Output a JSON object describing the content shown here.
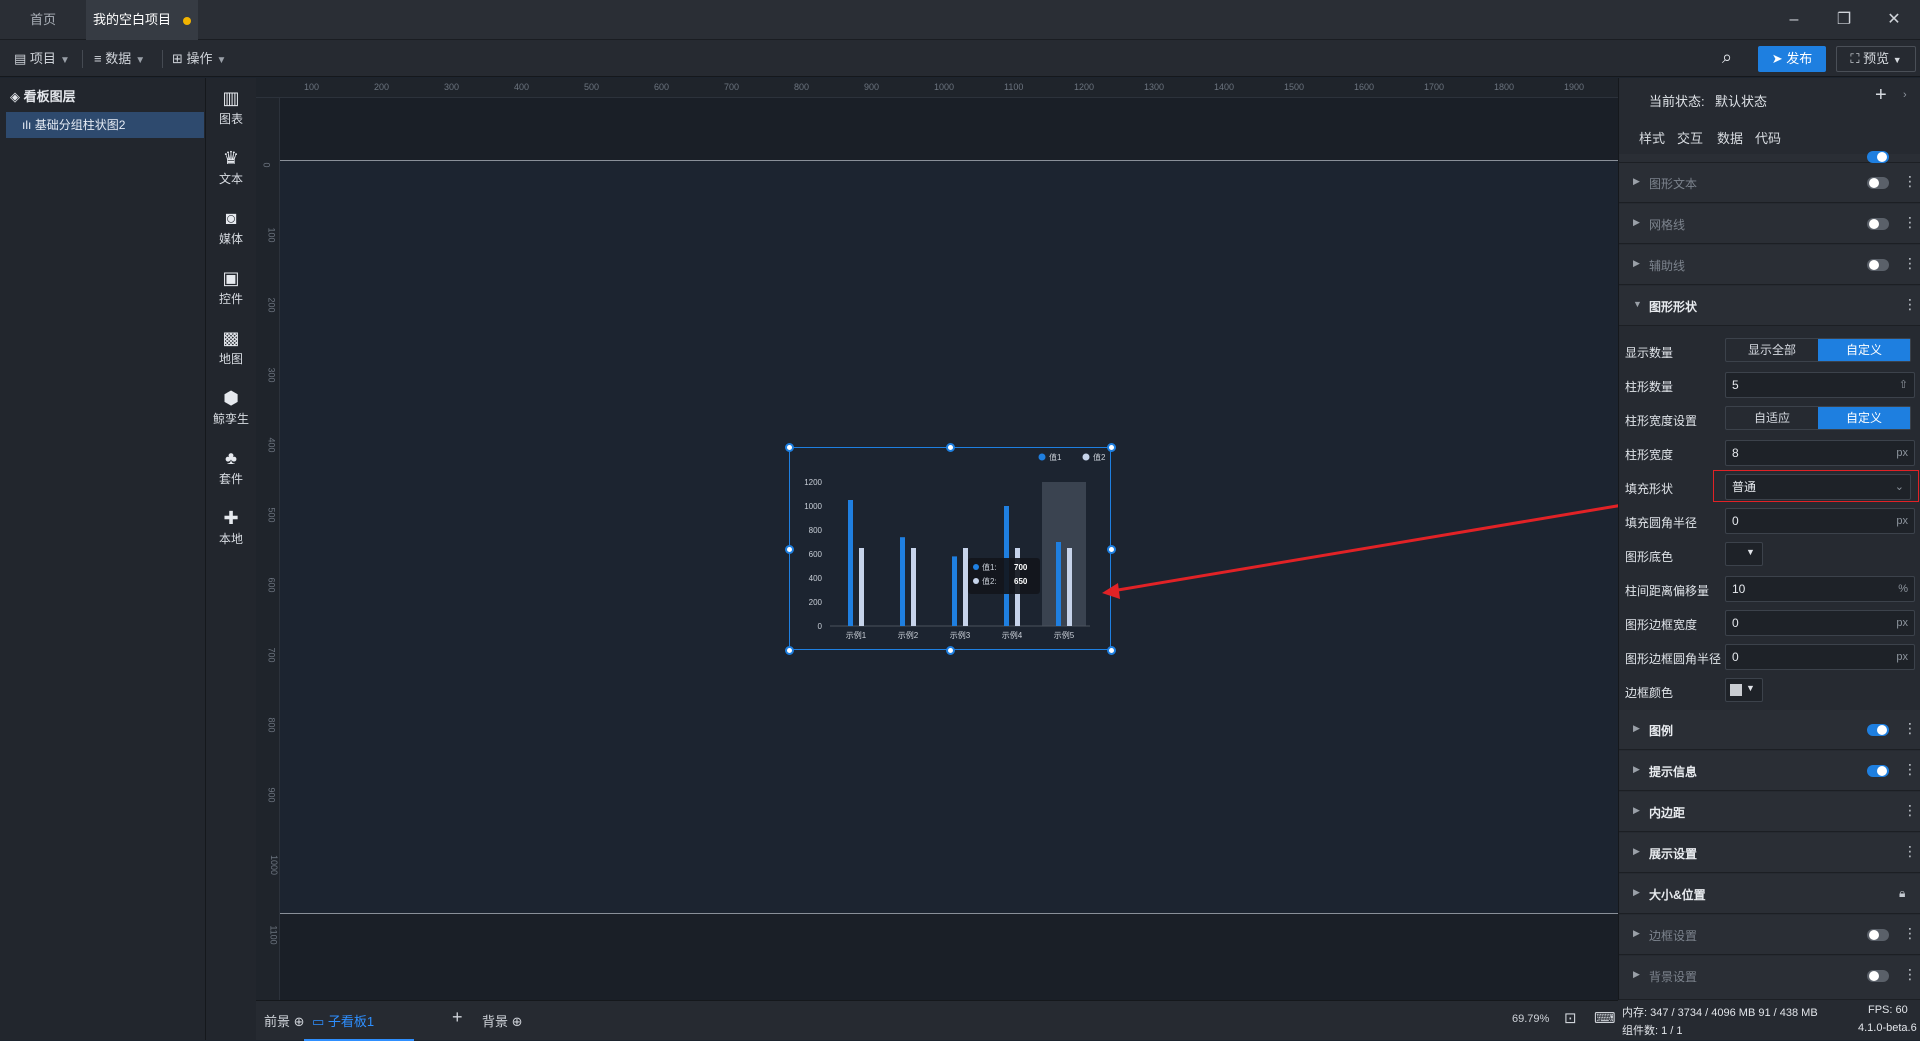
{
  "titlebar": {
    "tabs": [
      {
        "label": "首页"
      },
      {
        "label": "我的空白项目"
      }
    ]
  },
  "toolbar": {
    "menus": [
      {
        "label": "项目"
      },
      {
        "label": "数据"
      },
      {
        "label": "操作"
      }
    ],
    "publish": "发布",
    "preview": "预览"
  },
  "layers": {
    "title": "看板图层",
    "items": [
      {
        "label": "基础分组柱状图2"
      }
    ]
  },
  "components": [
    {
      "label": "图表",
      "icon": "bar-chart-icon"
    },
    {
      "label": "文本",
      "icon": "text-icon"
    },
    {
      "label": "媒体",
      "icon": "media-icon"
    },
    {
      "label": "控件",
      "icon": "control-icon"
    },
    {
      "label": "地图",
      "icon": "map-icon"
    },
    {
      "label": "鲸孪生",
      "icon": "twin-icon"
    },
    {
      "label": "套件",
      "icon": "kit-icon"
    },
    {
      "label": "本地",
      "icon": "local-icon"
    }
  ],
  "ruler": {
    "top": [
      "100",
      "200",
      "300",
      "400",
      "500",
      "600",
      "700",
      "800",
      "900",
      "1000",
      "1100",
      "1200",
      "1300",
      "1400",
      "1500",
      "1600",
      "1700",
      "1800",
      "1900"
    ],
    "left": [
      "0",
      "100",
      "200",
      "300",
      "400",
      "500",
      "600",
      "700",
      "800",
      "900",
      "1000",
      "1100"
    ]
  },
  "chart_data": {
    "type": "bar",
    "categories": [
      "示例1",
      "示例2",
      "示例3",
      "示例4",
      "示例5"
    ],
    "series": [
      {
        "name": "值1",
        "values": [
          1050,
          740,
          580,
          1000,
          700
        ],
        "color": "#1f7fe0"
      },
      {
        "name": "值2",
        "values": [
          650,
          650,
          650,
          650,
          650
        ],
        "color": "#c6d3ea"
      }
    ],
    "yticks": [
      "1200",
      "1000",
      "800",
      "600",
      "400",
      "200",
      "0"
    ],
    "ylim": [
      0,
      1200
    ],
    "legend_position": "top-right",
    "tooltip": {
      "rows": [
        {
          "name": "值1:",
          "value": "700"
        },
        {
          "name": "值2:",
          "value": "650"
        }
      ]
    }
  },
  "bottombar": {
    "foreground": "前景",
    "subboard": "子看板1",
    "background": "背景",
    "zoom": "69.79%"
  },
  "rpanel": {
    "state_label": "当前状态:",
    "state_value": "默认状态",
    "tabs": [
      {
        "label": "样式"
      },
      {
        "label": "交互"
      },
      {
        "label": "数据"
      },
      {
        "label": "代码"
      }
    ],
    "sections_top": [
      {
        "label": "图形文本"
      },
      {
        "label": "网格线"
      },
      {
        "label": "辅助线"
      }
    ],
    "shape_section": "图形形状",
    "props": {
      "show_count": {
        "label": "显示数量",
        "opt1": "显示全部",
        "opt2": "自定义"
      },
      "bar_count": {
        "label": "柱形数量",
        "value": "5"
      },
      "bar_width_setting": {
        "label": "柱形宽度设置",
        "opt1": "自适应",
        "opt2": "自定义"
      },
      "bar_width": {
        "label": "柱形宽度",
        "value": "8",
        "unit": "px"
      },
      "fill_shape": {
        "label": "填充形状",
        "value": "普通"
      },
      "fill_radius": {
        "label": "填充圆角半径",
        "value": "0",
        "unit": "px"
      },
      "shape_bg": {
        "label": "图形底色"
      },
      "bar_offset": {
        "label": "柱间距离偏移量",
        "value": "10",
        "unit": "%"
      },
      "border_width": {
        "label": "图形边框宽度",
        "value": "0",
        "unit": "px"
      },
      "border_radius": {
        "label": "图形边框圆角半径",
        "value": "0",
        "unit": "px"
      },
      "border_color": {
        "label": "边框颜色"
      }
    },
    "sections_bottom": [
      {
        "label": "图例"
      },
      {
        "label": "提示信息"
      },
      {
        "label": "内边距"
      },
      {
        "label": "展示设置"
      },
      {
        "label": "大小&位置"
      },
      {
        "label": "边框设置"
      },
      {
        "label": "背景设置"
      }
    ]
  },
  "status": {
    "mem": "内存: 347 / 3734 / 4096 MB 91 / 438 MB",
    "fps": "FPS: 60",
    "components": "组件数: 1 / 1",
    "version": "4.1.0-beta.6"
  }
}
